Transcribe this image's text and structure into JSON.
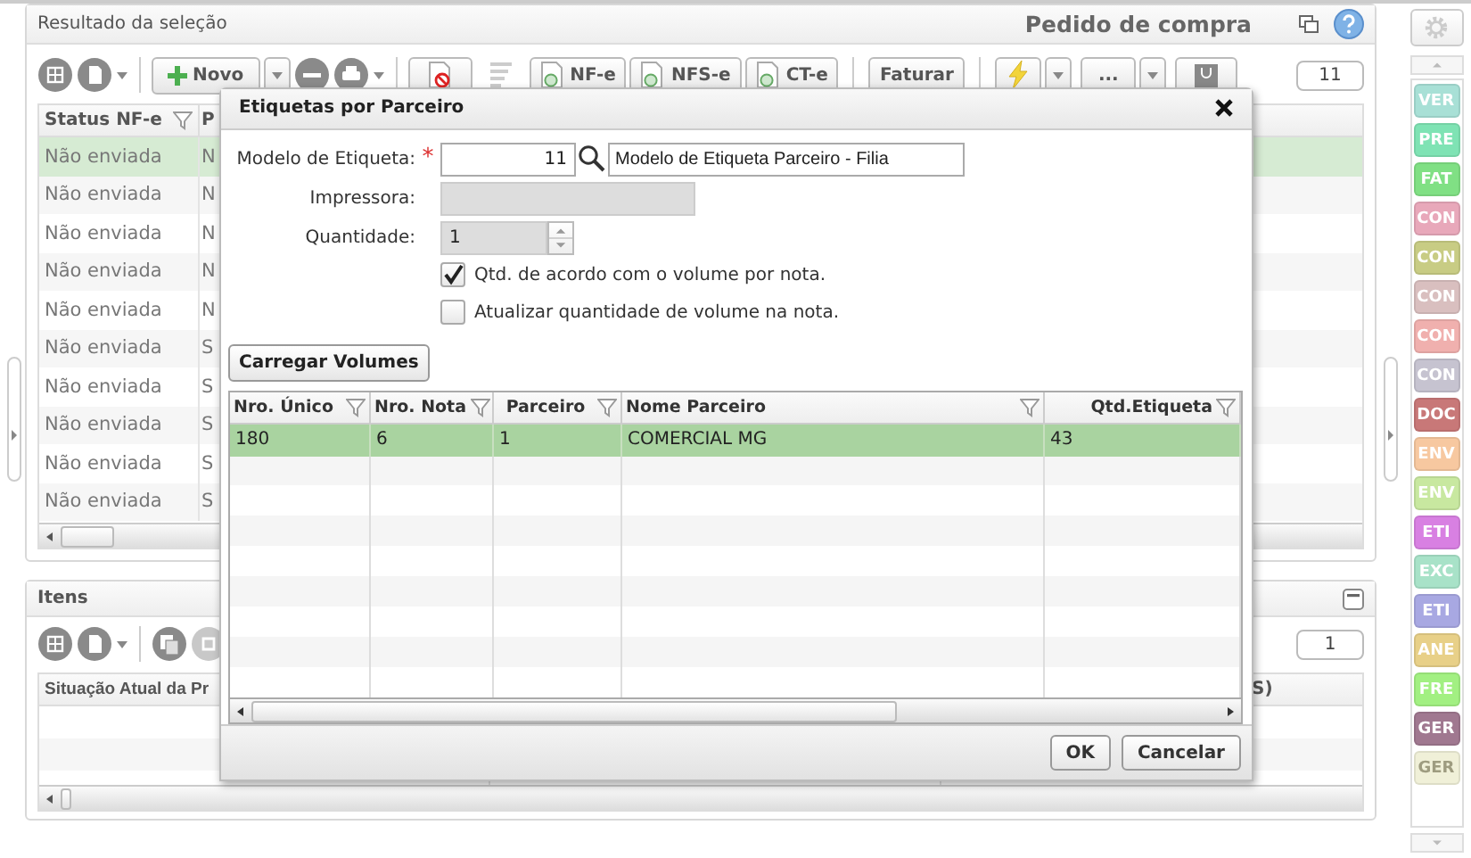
{
  "results_panel": {
    "title": "Resultado da seleção",
    "context_title": "Pedido de compra",
    "toolbar": {
      "buttons": [
        {
          "label": "Novo"
        },
        {
          "label": "NF-e"
        },
        {
          "label": "NFS-e"
        },
        {
          "label": "CT-e"
        },
        {
          "label": "Faturar"
        },
        {
          "label": "..."
        }
      ],
      "count": "11"
    },
    "grid": {
      "columns": [
        "Status NF-e",
        "P"
      ],
      "rows": [
        {
          "cells": [
            "Não enviada",
            "N"
          ],
          "selected": true
        },
        {
          "cells": [
            "Não enviada",
            "N"
          ],
          "selected": false
        },
        {
          "cells": [
            "Não enviada",
            "N"
          ],
          "selected": false
        },
        {
          "cells": [
            "Não enviada",
            "N"
          ],
          "selected": false
        },
        {
          "cells": [
            "Não enviada",
            "N"
          ],
          "selected": false
        },
        {
          "cells": [
            "Não enviada",
            "S"
          ],
          "selected": false
        },
        {
          "cells": [
            "Não enviada",
            "S"
          ],
          "selected": false
        },
        {
          "cells": [
            "Não enviada",
            "S"
          ],
          "selected": false
        },
        {
          "cells": [
            "Não enviada",
            "S"
          ],
          "selected": false
        },
        {
          "cells": [
            "Não enviada",
            "S"
          ],
          "selected": false
        }
      ]
    }
  },
  "items_panel": {
    "title": "Itens",
    "count": "1",
    "grid": {
      "columns": [
        "Situação Atual da Pr",
        "S)"
      ]
    }
  },
  "dialog": {
    "title": "Etiquetas por Parceiro",
    "model": {
      "label": "Modelo de Etiqueta:",
      "required_mark": "*",
      "code": "11",
      "name": "Modelo de Etiqueta Parceiro - Filia"
    },
    "printer": {
      "label": "Impressora:",
      "disabled": true
    },
    "quantity": {
      "label": "Quantidade:",
      "value": "1",
      "disabled": true
    },
    "checkboxes": [
      {
        "label": "Qtd. de acordo com o volume por nota.",
        "checked": true
      },
      {
        "label": "Atualizar quantidade de volume na nota.",
        "checked": false
      }
    ],
    "load_button": "Carregar Volumes",
    "grid": {
      "columns": [
        "Nro. Único",
        "Nro. Nota",
        "Parceiro",
        "Nome Parceiro",
        "Qtd.Etiqueta"
      ],
      "rows": [
        {
          "cells": [
            "180",
            "6",
            "1",
            "COMERCIAL MG",
            "43"
          ],
          "selected": true
        }
      ]
    },
    "buttons": [
      "OK",
      "Cancelar"
    ]
  },
  "sidebar": {
    "buttons": [
      {
        "label": "VER",
        "color": "#a8e0d6"
      },
      {
        "label": "PRE",
        "color": "#7fe3b4"
      },
      {
        "label": "FAT",
        "color": "#80e084"
      },
      {
        "label": "CON",
        "color": "#e8a8ba"
      },
      {
        "label": "CON",
        "color": "#c8cc84"
      },
      {
        "label": "CON",
        "color": "#d9bfbf"
      },
      {
        "label": "CON",
        "color": "#f0b0ae"
      },
      {
        "label": "CON",
        "color": "#c6c3d0"
      },
      {
        "label": "DOC",
        "color": "#c87878"
      },
      {
        "label": "ENV",
        "color": "#f7c8a0"
      },
      {
        "label": "ENV",
        "color": "#c8e8a0"
      },
      {
        "label": "ETI",
        "color": "#d880e2"
      },
      {
        "label": "EXC",
        "color": "#a8e2c8"
      },
      {
        "label": "ETI",
        "color": "#a8a8e2"
      },
      {
        "label": "ANE",
        "color": "#e8d088"
      },
      {
        "label": "FRE",
        "color": "#a2f082"
      },
      {
        "label": "GER",
        "color": "#a07890"
      },
      {
        "label": "GER",
        "color": "#f0f0d8"
      }
    ]
  }
}
